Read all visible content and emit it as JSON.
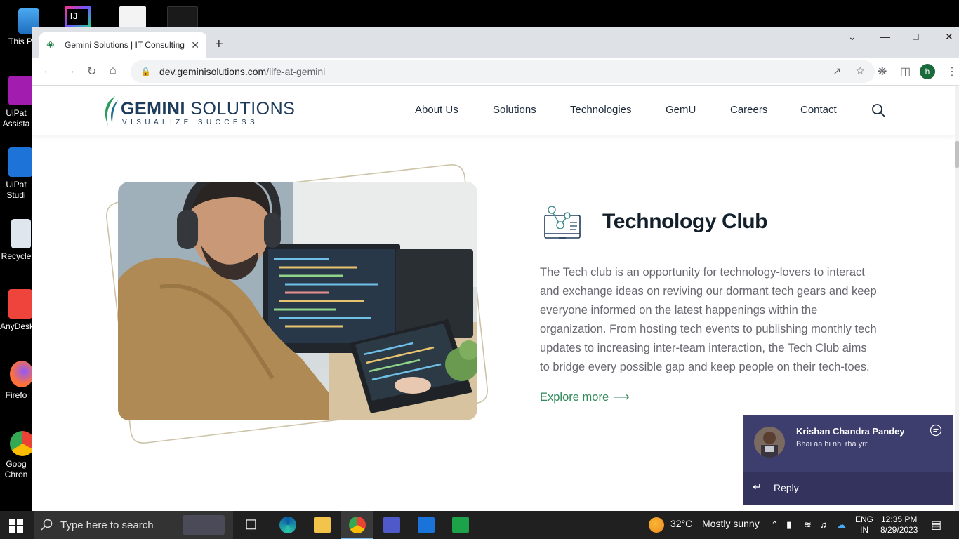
{
  "desktop": {
    "icons": [
      "This P",
      "UiPat\nAssista",
      "UiPat\nStudi",
      "Recycle",
      "AnyDesk",
      "Firefo",
      "Goog\nChron"
    ]
  },
  "browser": {
    "tab_title": "Gemini Solutions | IT Consulting",
    "url_domain": "dev.geminisolutions.com",
    "url_path": "/life-at-gemini",
    "profile_initial": "h"
  },
  "site": {
    "logo_main": "GEMINI",
    "logo_secondary": "SOLUTIONS",
    "logo_tagline": "VISUALIZE SUCCESS",
    "nav": [
      "About Us",
      "Solutions",
      "Technologies",
      "GemU",
      "Careers",
      "Contact"
    ]
  },
  "section": {
    "title": "Technology Club",
    "description_lines": [
      "The Tech club is an opportunity for technology-lovers to interact",
      "and exchange ideas on reviving our dormant tech gears and keep",
      "everyone informed on the latest happenings within the",
      "organization. From hosting tech events to publishing monthly tech",
      "updates to increasing inter-team interaction, the Tech Club aims",
      "to bridge every possible gap and keep people on their tech-toes."
    ],
    "cta": "Explore more"
  },
  "notification": {
    "sender": "Krishan Chandra Pandey",
    "message": "Bhai aa hi nhi rha yrr",
    "reply_label": "Reply"
  },
  "taskbar": {
    "search_placeholder": "Type here to search",
    "weather_temp": "32°C",
    "weather_desc": "Mostly sunny",
    "lang_line1": "ENG",
    "lang_line2": "IN",
    "time": "12:35 PM",
    "date": "8/29/2023"
  },
  "colors": {
    "accent_green": "#2f8a5a",
    "brand_navy": "#1d3b5c",
    "teams_purple": "#3d3d6e"
  }
}
